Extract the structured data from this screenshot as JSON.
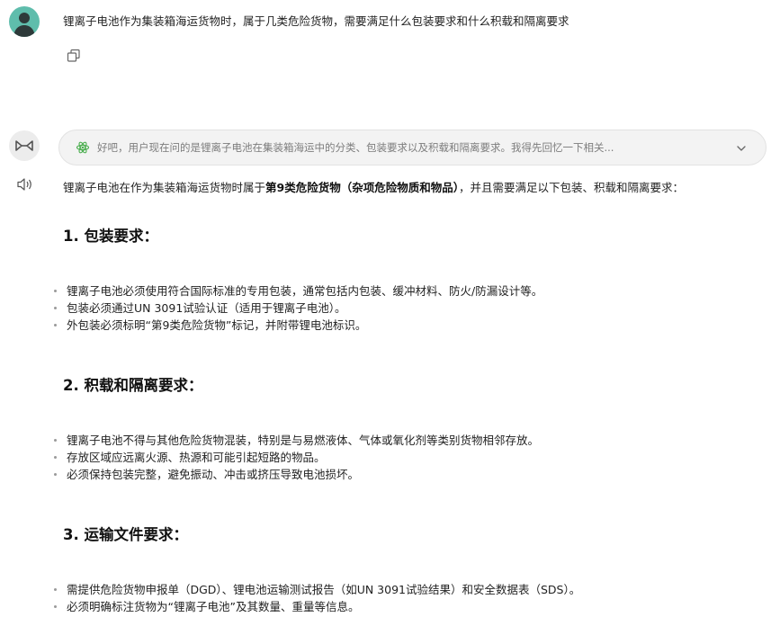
{
  "user": {
    "message": "锂离子电池作为集装箱海运货物时，属于几类危险货物，需要满足什么包装要求和什么积载和隔离要求"
  },
  "assistant": {
    "thinking_summary": "好吧，用户现在问的是锂离子电池在集装箱海运中的分类、包装要求以及积载和隔离要求。我得先回忆一下相关...",
    "intro_prefix": "锂离子电池在作为集装箱海运货物时属于",
    "intro_bold": "第9类危险货物（杂项危险物质和物品）",
    "intro_suffix": "，并且需要满足以下包装、积载和隔离要求：",
    "sections": [
      {
        "title": "1. 包装要求：",
        "items": [
          "锂离子电池必须使用符合国际标准的专用包装，通常包括内包装、缓冲材料、防火/防漏设计等。",
          "包装必须通过UN 3091试验认证（适用于锂离子电池）。",
          "外包装必须标明“第9类危险货物”标记，并附带锂电池标识。"
        ]
      },
      {
        "title": "2. 积载和隔离要求：",
        "items": [
          "锂离子电池不得与其他危险货物混装，特别是与易燃液体、气体或氧化剂等类别货物相邻存放。",
          "存放区域应远离火源、热源和可能引起短路的物品。",
          "必须保持包装完整，避免振动、冲击或挤压导致电池损坏。"
        ]
      },
      {
        "title": "3. 运输文件要求：",
        "items": [
          "需提供危险货物申报单（DGD）、锂电池运输测试报告（如UN 3091试验结果）和安全数据表（SDS）。",
          "必须明确标注货物为“锂离子电池”及其数量、重量等信息。"
        ]
      }
    ]
  },
  "icons": {
    "user_avatar": "user-avatar-icon",
    "copy": "copy-icon",
    "bot": "infinity-logo-icon",
    "speaker": "speaker-icon",
    "thinking": "atom-icon",
    "expand": "chevron-down-icon"
  },
  "colors": {
    "avatar": "#5fbdac",
    "thinking_icon": "#4caf50",
    "bullet": "#9a9a9a"
  }
}
